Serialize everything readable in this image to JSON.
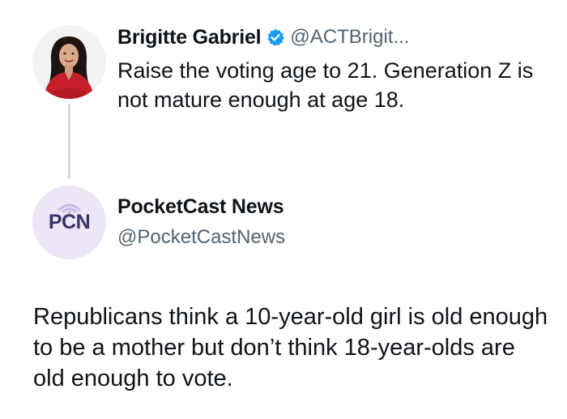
{
  "parent_tweet": {
    "author_name": "Brigitte Gabriel",
    "author_handle": "@ACTBrigit...",
    "verified": true,
    "verified_color": "#1d9bf0",
    "avatar_icon": "profile-photo-woman-red-top",
    "text": "Raise the voting age to 21. Generation Z is not mature enough at age 18."
  },
  "main_tweet": {
    "author_name": "PocketCast News",
    "author_handle": "@PocketCastNews",
    "avatar_logo_text": "PCN",
    "avatar_icon": "broadcast-signal-icon",
    "logo_color": "#3a3166",
    "avatar_bg_color": "#ece6f7",
    "text": "Republicans think a 10-year-old girl is old enough to be a mother but don’t think 18-year-olds are old enough to vote."
  },
  "colors": {
    "text_primary": "#0f1419",
    "text_secondary": "#536471",
    "thread_line": "#cfd9de"
  }
}
